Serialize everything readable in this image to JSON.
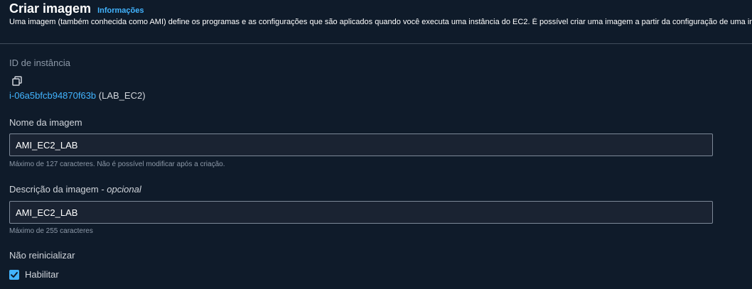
{
  "header": {
    "title": "Criar imagem",
    "info_link": "Informações",
    "description": "Uma imagem (também conhecida como AMI) define os programas e as configurações que são aplicados quando você executa uma instância do EC2. É possível criar uma imagem a partir da configuração de uma instância existente."
  },
  "instance": {
    "label": "ID de instância",
    "id": "i-06a5bfcb94870f63b",
    "name": "(LAB_EC2)"
  },
  "image_name": {
    "label": "Nome da imagem",
    "value": "AMI_EC2_LAB",
    "hint": "Máximo de 127 caracteres. Não é possível modificar após a criação."
  },
  "image_description": {
    "label": "Descrição da imagem - ",
    "label_optional": "opcional",
    "value": "AMI_EC2_LAB",
    "hint": "Máximo de 255 caracteres"
  },
  "no_reboot": {
    "label": "Não reinicializar",
    "checkbox_label": "Habilitar",
    "checked": true
  },
  "colors": {
    "background": "#0f1b2a",
    "accent": "#42b4ff",
    "input_bg": "#1a2332",
    "input_border": "#7d8998"
  },
  "icons": {
    "copy": "copy-icon",
    "check": "check-icon"
  }
}
